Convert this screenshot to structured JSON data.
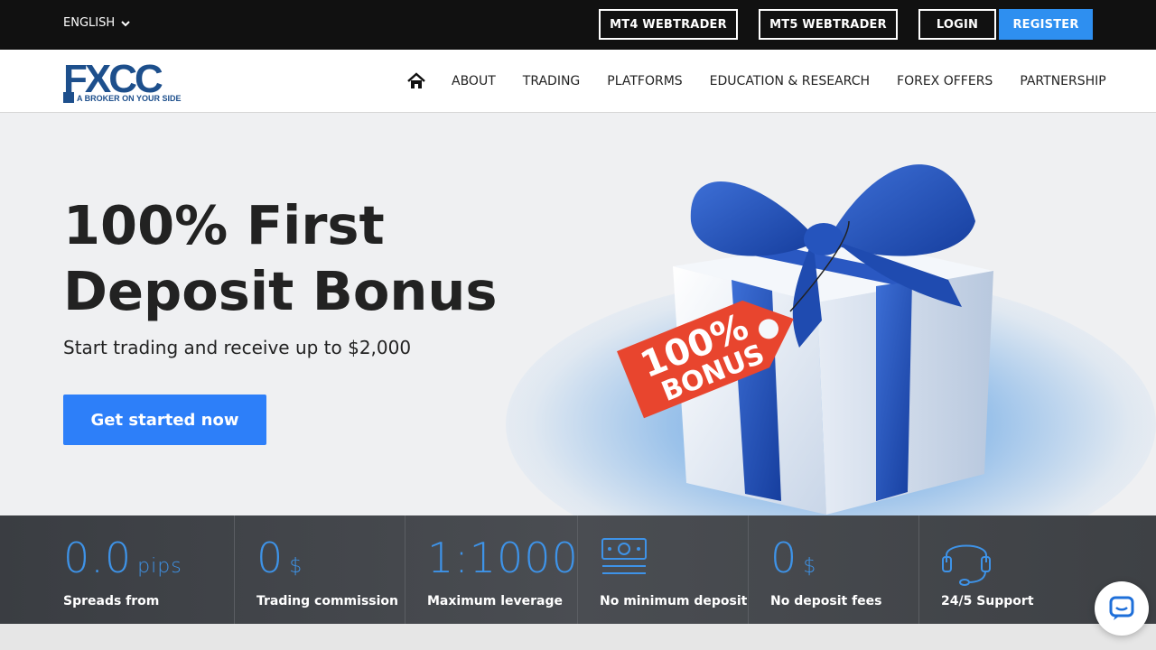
{
  "topbar": {
    "language": "ENGLISH",
    "mt4": "MT4 WEBTRADER",
    "mt5": "MT5 WEBTRADER",
    "login": "LOGIN",
    "register": "REGISTER"
  },
  "logo": {
    "letters_fx": "FX",
    "letters_cc": "CC",
    "tagline": "A BROKER ON YOUR SIDE"
  },
  "nav": {
    "items": [
      "ABOUT",
      "TRADING",
      "PLATFORMS",
      "EDUCATION & RESEARCH",
      "FOREX OFFERS",
      "PARTNERSHIP"
    ]
  },
  "hero": {
    "title_line1": "100% First",
    "title_line2": "Deposit Bonus",
    "subtitle": "Start trading and receive up to $2,000",
    "cta": "Get started now",
    "tag_line1": "100%",
    "tag_line2": "BONUS"
  },
  "stats": [
    {
      "value": "0.0",
      "unit": "pips",
      "label": "Spreads from"
    },
    {
      "value": "0",
      "unit": "$",
      "label": "Trading commission"
    },
    {
      "value": "1:1000",
      "unit": "",
      "label": "Maximum leverage"
    },
    {
      "icon": "money-icon",
      "label": "No minimum deposit"
    },
    {
      "value": "0",
      "unit": "$",
      "label": "No deposit fees"
    },
    {
      "icon": "headset-icon",
      "label": "24/5 Support"
    }
  ],
  "colors": {
    "accent": "#2d7ff9",
    "register": "#2e8ff0",
    "stat_value": "#3e93e8",
    "brand": "#1d4f8c",
    "tag": "#e8452e"
  }
}
